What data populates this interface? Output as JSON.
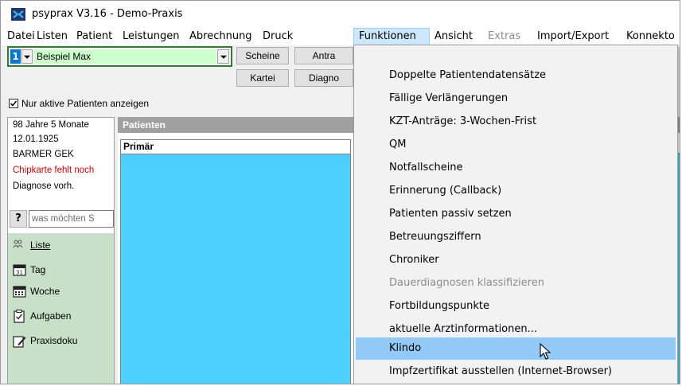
{
  "window": {
    "title": "psyprax V3.16 - Demo-Praxis"
  },
  "menubar": {
    "items": [
      {
        "label": "Datei",
        "state": "normal"
      },
      {
        "label": "Listen",
        "state": "normal"
      },
      {
        "label": "Patient",
        "state": "normal"
      },
      {
        "label": "Leistungen",
        "state": "normal"
      },
      {
        "label": "Abrechnung",
        "state": "normal"
      },
      {
        "label": "Druck",
        "state": "normal"
      },
      {
        "label": "Funktionen",
        "state": "active"
      },
      {
        "label": "Ansicht",
        "state": "normal"
      },
      {
        "label": "Extras",
        "state": "disabled"
      },
      {
        "label": "Import/Export",
        "state": "normal"
      },
      {
        "label": "Konnekto",
        "state": "normal"
      }
    ]
  },
  "patient_selector": {
    "number": "1",
    "name": "Beispiel Max"
  },
  "toolbar": {
    "scheine": "Scheine",
    "antrag": "Antra",
    "kartei": "Kartei",
    "diagnose": "Diagno"
  },
  "filter": {
    "active_only_label": "Nur aktive Patienten anzeigen",
    "active_only_checked": true
  },
  "patient_info": {
    "age": "98 Jahre 5 Monate",
    "birthdate": "12.01.1925",
    "insurance": "BARMER GEK",
    "card_warning": "Chipkarte fehlt noch",
    "diagnosis": "Diagnose vorh."
  },
  "search": {
    "help_label": "?",
    "placeholder": "was möchten S"
  },
  "nav": {
    "items": [
      {
        "label": "Liste",
        "icon": "people-icon"
      },
      {
        "label": "Tag",
        "icon": "calendar-day-icon"
      },
      {
        "label": "Woche",
        "icon": "calendar-week-icon"
      },
      {
        "label": "Aufgaben",
        "icon": "tasks-icon"
      },
      {
        "label": "Praxisdoku",
        "icon": "document-edit-icon"
      }
    ]
  },
  "patients_panel": {
    "header": "Patienten",
    "column_primary": "Primär"
  },
  "funktionen_menu": {
    "items": [
      {
        "label": "Doppelte Patientendatensätze",
        "state": "normal"
      },
      {
        "label": "Fällige Verlängerungen",
        "state": "normal"
      },
      {
        "label": "KZT-Anträge: 3-Wochen-Frist",
        "state": "normal"
      },
      {
        "label": "QM",
        "state": "normal"
      },
      {
        "label": "Notfallscheine",
        "state": "normal"
      },
      {
        "label": "Erinnerung (Callback)",
        "state": "normal"
      },
      {
        "label": "Patienten passiv setzen",
        "state": "normal"
      },
      {
        "label": "Betreuungsziffern",
        "state": "normal"
      },
      {
        "label": "Chroniker",
        "state": "normal"
      },
      {
        "label": "Dauerdiagnosen klassifizieren",
        "state": "disabled"
      },
      {
        "label": "Fortbildungspunkte",
        "state": "normal"
      },
      {
        "label": "aktuelle Arztinformationen...",
        "state": "normal"
      },
      {
        "label": "Klindo",
        "state": "hover"
      },
      {
        "label": "Impfzertifikat ausstellen (Internet-Browser)",
        "state": "normal"
      }
    ]
  },
  "colors": {
    "accent_green": "#2f7d2f",
    "patient_field": "#ccffcc",
    "list_blue": "#4dcfff",
    "menu_hover": "#91c9f7",
    "warning_red": "#e00000"
  }
}
